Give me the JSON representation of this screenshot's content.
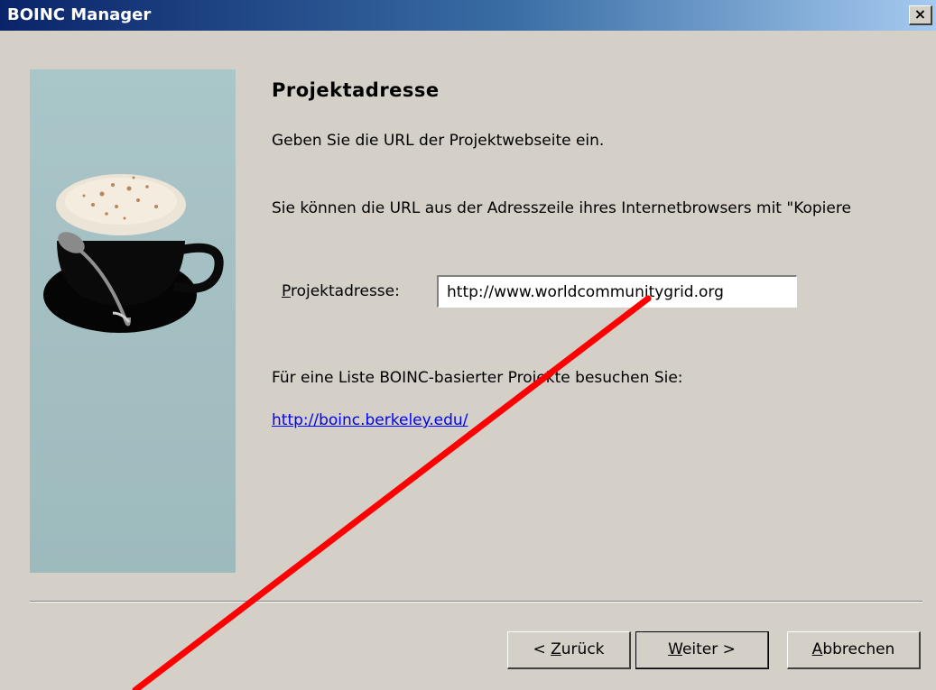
{
  "window": {
    "title": "BOINC Manager",
    "close_label": "×"
  },
  "wizard": {
    "heading": "Projektadresse",
    "intro": "Geben Sie die URL der Projektwebseite ein.",
    "hint": "Sie können die URL aus der Adresszeile ihres Internetbrowsers mit \"Kopiere",
    "address_label_prefix": "P",
    "address_label_rest": "rojektadresse:",
    "address_value": "http://www.worldcommunitygrid.org",
    "list_text": "Für eine Liste BOINC-basierter Projekte besuchen Sie:",
    "link_text": "http://boinc.berkeley.edu/"
  },
  "buttons": {
    "back_prefix": "< ",
    "back_access": "Z",
    "back_rest": "urück",
    "next_access": "W",
    "next_rest": "eiter >",
    "cancel_access": "A",
    "cancel_rest": "bbrechen"
  },
  "colors": {
    "annotation_line": "#ff0000",
    "link": "#0000ff",
    "dialog_bg": "#d4d0c8"
  },
  "icons": {
    "side_image": "coffee-cup-image",
    "close": "close-icon"
  }
}
